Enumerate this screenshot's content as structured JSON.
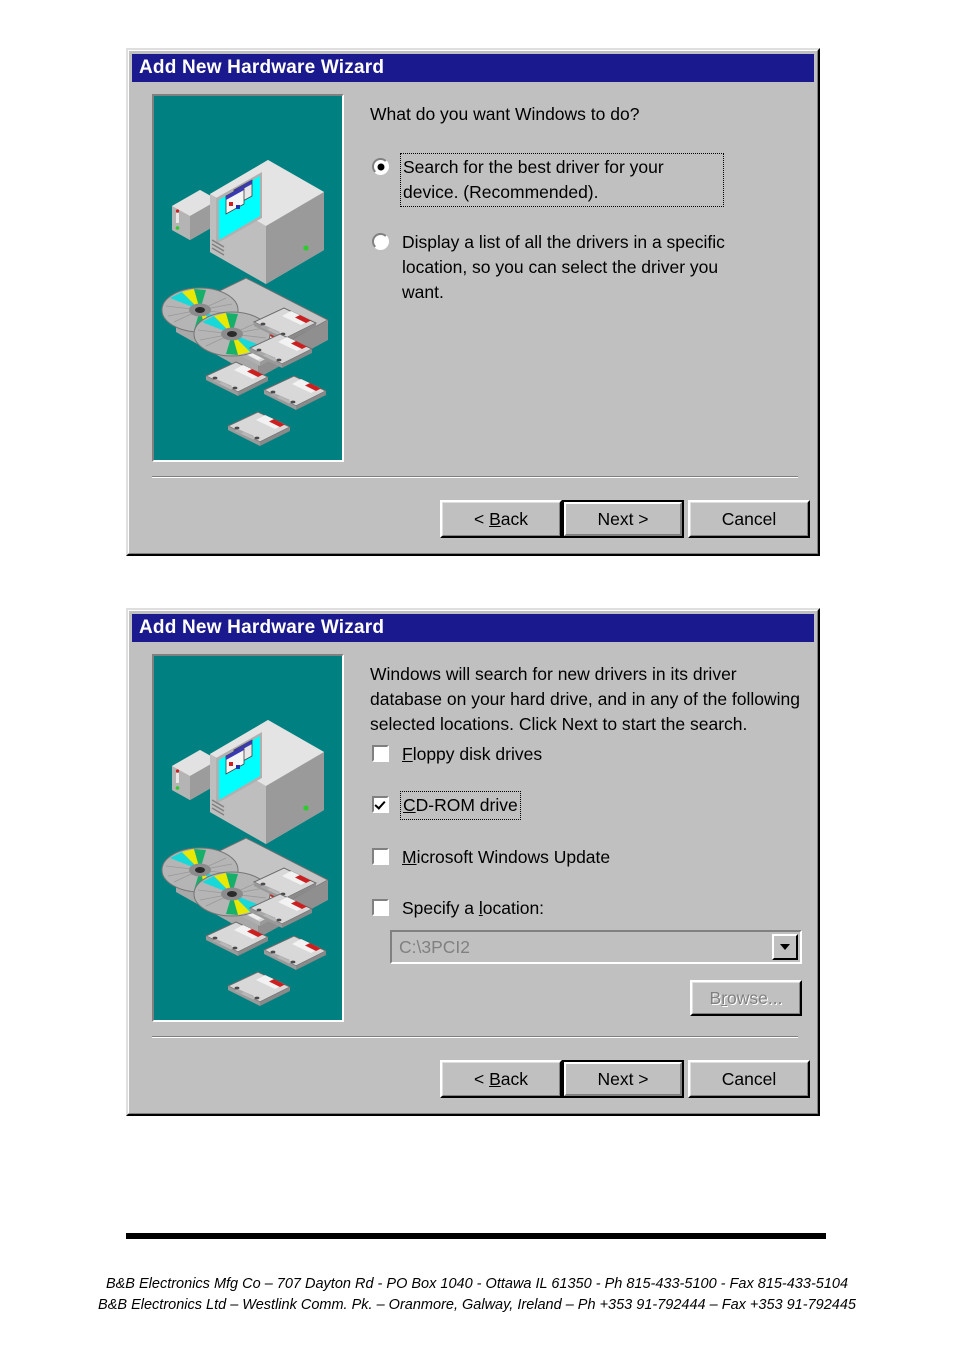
{
  "page": {
    "rule": {
      "present": true
    },
    "footer_lines": [
      "B&B Electronics Mfg Co – 707 Dayton Rd - PO Box 1040 - Ottawa IL 61350 - Ph 815-433-5100 - Fax 815-433-5104",
      "B&B Electronics Ltd – Westlink Comm. Pk. – Oranmore, Galway, Ireland – Ph +353 91-792444 – Fax +353 91-792445"
    ]
  },
  "colors": {
    "titlebar": "#1a1a8e",
    "dialog_face": "#c0c0c0",
    "artwork_background": "#008080",
    "monitor_screen": "#00ffff",
    "disabled_text": "#808080"
  },
  "dialog1": {
    "title": "Add New Hardware Wizard",
    "prompt": "What do you want Windows to do?",
    "options": [
      {
        "id": "search-best-driver",
        "label": "Search for the best driver for your device. (Recommended).",
        "selected": true,
        "focused": true
      },
      {
        "id": "display-driver-list",
        "label": "Display a list of all the drivers in a specific location, so you can select the driver you want.",
        "selected": false,
        "focused": false
      }
    ],
    "buttons": [
      {
        "id": "back",
        "label": "< Back",
        "default": false,
        "disabled": false
      },
      {
        "id": "next",
        "label": "Next >",
        "default": true,
        "disabled": false
      },
      {
        "id": "cancel",
        "label": "Cancel",
        "default": false,
        "disabled": false
      }
    ]
  },
  "dialog2": {
    "title": "Add New Hardware Wizard",
    "prompt": "Windows will search for new drivers in its driver database on your hard drive, and in any of the following selected locations. Click Next to start the search.",
    "checkboxes": [
      {
        "id": "floppy-disk-drives",
        "label": "Floppy disk drives",
        "checked": false,
        "focused": false
      },
      {
        "id": "cd-rom-drive",
        "label": "CD-ROM drive",
        "checked": true,
        "focused": true
      },
      {
        "id": "microsoft-windows-update",
        "label": "Microsoft Windows Update",
        "checked": false,
        "focused": false
      },
      {
        "id": "specify-a-location",
        "label": "Specify a location:",
        "checked": false,
        "focused": false
      }
    ],
    "location_combo": {
      "value": "C:\\3PCI2",
      "disabled": true
    },
    "browse_button": {
      "label": "Browse...",
      "disabled": true
    },
    "buttons": [
      {
        "id": "back",
        "label": "< Back",
        "default": false,
        "disabled": false
      },
      {
        "id": "next",
        "label": "Next >",
        "default": true,
        "disabled": false
      },
      {
        "id": "cancel",
        "label": "Cancel",
        "default": false,
        "disabled": false
      }
    ]
  }
}
